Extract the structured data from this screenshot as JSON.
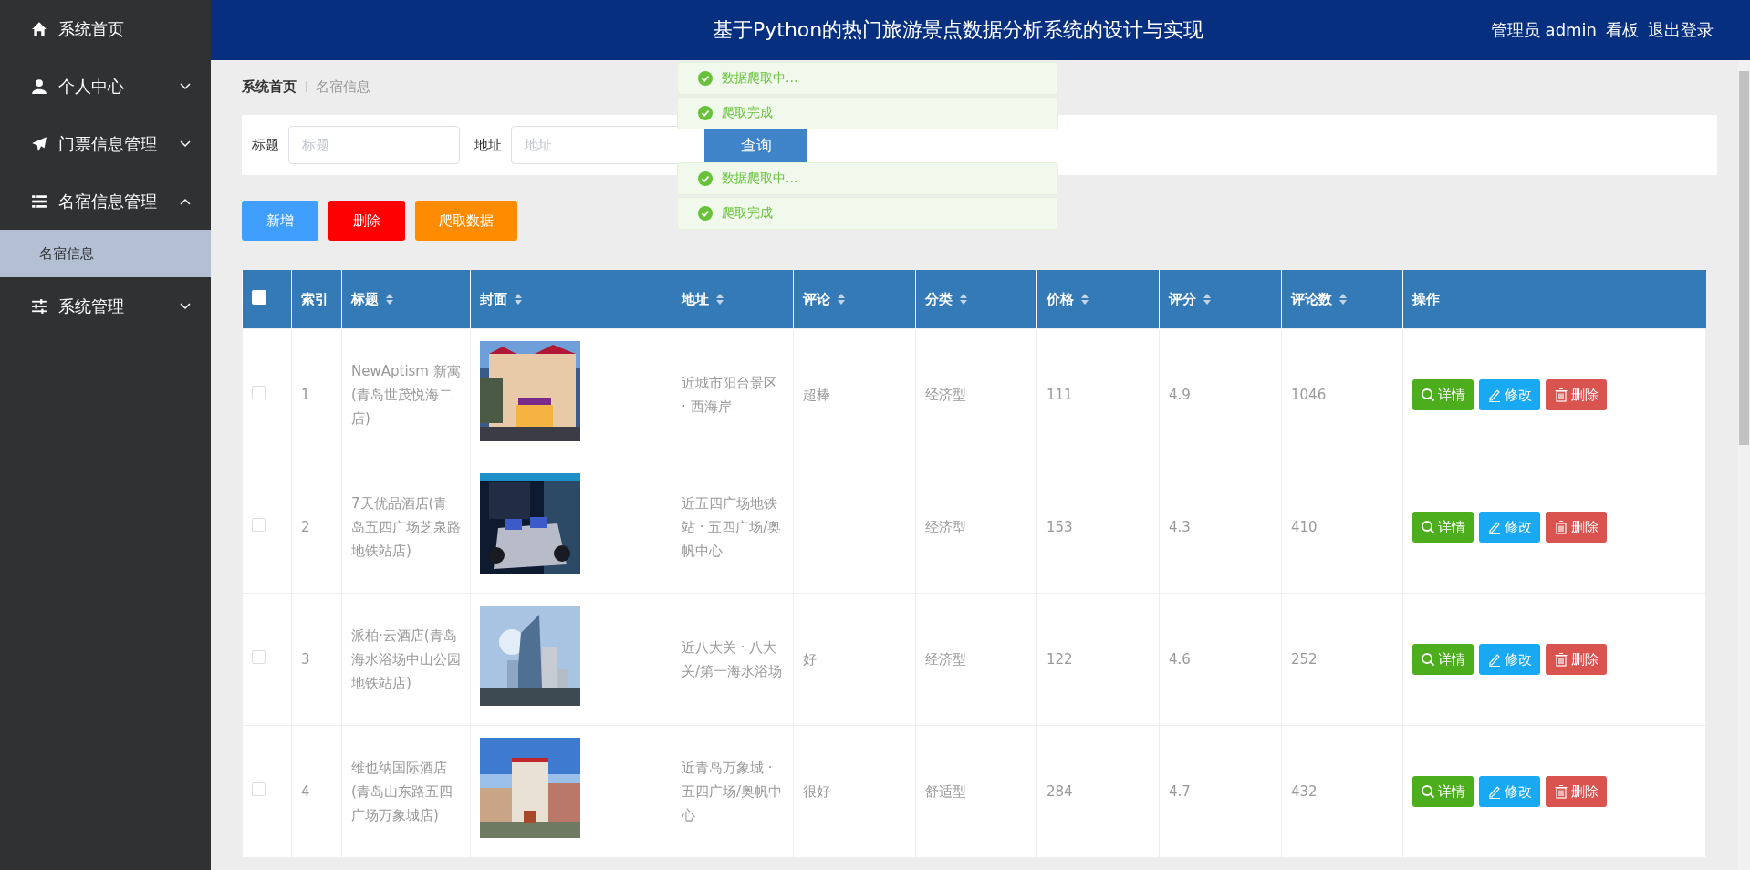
{
  "sidebar": {
    "items": [
      {
        "label": "系统首页"
      },
      {
        "label": "个人中心",
        "expanded": false
      },
      {
        "label": "门票信息管理",
        "expanded": false
      },
      {
        "label": "名宿信息管理",
        "expanded": true,
        "children": [
          {
            "label": "名宿信息",
            "selected": true
          }
        ]
      },
      {
        "label": "系统管理",
        "expanded": false
      }
    ]
  },
  "header": {
    "title": "基于Python的热门旅游景点数据分析系统的设计与实现",
    "user": "管理员 admin",
    "links": [
      "看板",
      "退出登录"
    ]
  },
  "breadcrumb": [
    {
      "label": "系统首页",
      "current": false
    },
    {
      "label": "名宿信息",
      "current": true
    }
  ],
  "search": {
    "fields": [
      {
        "label": "标题",
        "placeholder": "标题"
      },
      {
        "label": "地址",
        "placeholder": "地址"
      }
    ],
    "button": "查询"
  },
  "actions": [
    {
      "label": "新增",
      "kind": "add"
    },
    {
      "label": "删除",
      "kind": "delete"
    },
    {
      "label": "爬取数据",
      "kind": "crawl"
    }
  ],
  "toasts": [
    {
      "text": "数据爬取中...",
      "kind": "success"
    },
    {
      "text": "爬取完成",
      "kind": "success"
    },
    {
      "text": "数据爬取中...",
      "kind": "success"
    },
    {
      "text": "爬取完成",
      "kind": "success"
    }
  ],
  "table": {
    "select_all": {
      "checked": false
    },
    "columns": [
      {
        "label": "索引",
        "sortable": false
      },
      {
        "label": "标题",
        "sortable": true
      },
      {
        "label": "封面",
        "sortable": true
      },
      {
        "label": "地址",
        "sortable": true
      },
      {
        "label": "评论",
        "sortable": true
      },
      {
        "label": "分类",
        "sortable": true
      },
      {
        "label": "价格",
        "sortable": true
      },
      {
        "label": "评分",
        "sortable": true
      },
      {
        "label": "评论数",
        "sortable": true
      },
      {
        "label": "操作",
        "sortable": false
      }
    ],
    "rows": [
      {
        "checked": false,
        "index": "1",
        "title": "NewAptism 新寓(青岛世茂悦海二店)",
        "cover": {
          "kind": "picture"
        },
        "address": "近城市阳台景区 · 西海岸",
        "comment": "超棒",
        "category": "经济型",
        "price": "111",
        "rating": "4.9",
        "review_count": "1046",
        "actions": [
          {
            "label": "详情",
            "kind": "detail"
          },
          {
            "label": "修改",
            "kind": "edit"
          },
          {
            "label": "删除",
            "kind": "remove"
          }
        ]
      },
      {
        "checked": false,
        "index": "2",
        "title": "7天优品酒店(青岛五四广场芝泉路地铁站店)",
        "cover": {
          "kind": "picture"
        },
        "address": "近五四广场地铁站 · 五四广场/奥帆中心",
        "category": "经济型",
        "price": "153",
        "rating": "4.3",
        "review_count": "410",
        "actions": [
          {
            "label": "详情",
            "kind": "detail"
          },
          {
            "label": "修改",
            "kind": "edit"
          },
          {
            "label": "删除",
            "kind": "remove"
          }
        ]
      },
      {
        "checked": false,
        "index": "3",
        "title": "派柏·云酒店(青岛海水浴场中山公园地铁站店)",
        "cover": {
          "kind": "picture"
        },
        "address": "近八大关 · 八大关/第一海水浴场",
        "comment": "好",
        "category": "经济型",
        "price": "122",
        "rating": "4.6",
        "review_count": "252",
        "actions": [
          {
            "label": "详情",
            "kind": "detail"
          },
          {
            "label": "修改",
            "kind": "edit"
          },
          {
            "label": "删除",
            "kind": "remove"
          }
        ]
      },
      {
        "checked": false,
        "index": "4",
        "title": "维也纳国际酒店(青岛山东路五四广场万象城店)",
        "cover": {
          "kind": "picture"
        },
        "address": "近青岛万象城 · 五四广场/奥帆中心",
        "comment": "很好",
        "category": "舒适型",
        "price": "284",
        "rating": "4.7",
        "review_count": "432",
        "actions": [
          {
            "label": "详情",
            "kind": "detail"
          },
          {
            "label": "修改",
            "kind": "edit"
          },
          {
            "label": "删除",
            "kind": "remove"
          }
        ]
      }
    ]
  }
}
